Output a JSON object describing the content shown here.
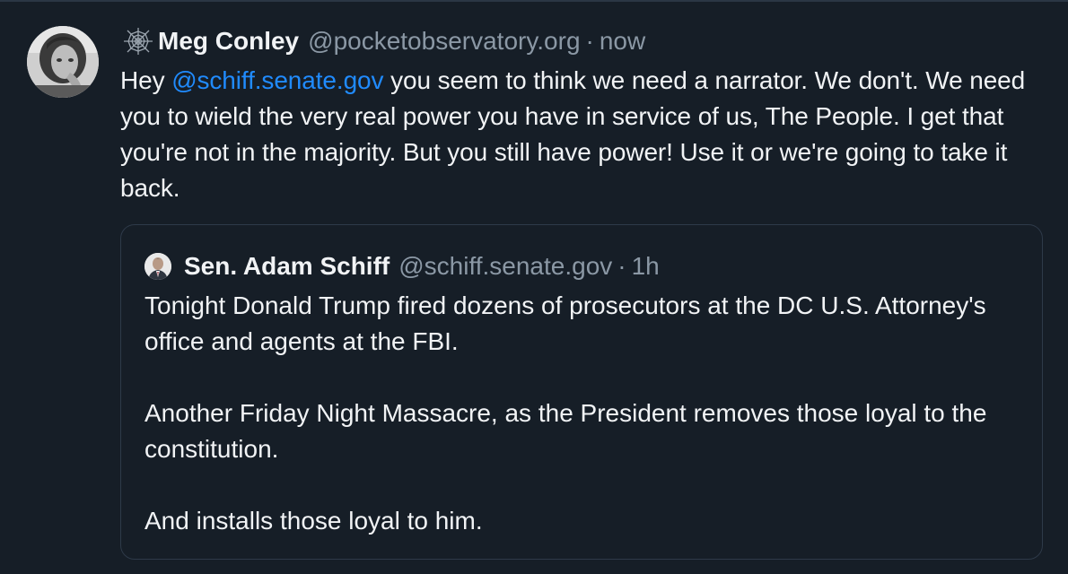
{
  "post": {
    "author": {
      "avatar_icon": "profile-photo-avatar",
      "badge_icon": "spiderweb-icon",
      "display_name": "Meg Conley",
      "handle": "@pocketobservatory.org",
      "separator": "·",
      "time": "now"
    },
    "text": {
      "before_mention": "Hey ",
      "mention": "@schiff.senate.gov",
      "after_mention": " you seem to think we need a narrator. We don't. We need you to wield the very real power you have in service of us, The People. I get that you're not in the majority. But you still have power! Use it or we're going to take it back."
    },
    "quote": {
      "author": {
        "avatar_icon": "profile-photo-avatar",
        "display_name": "Sen. Adam Schiff",
        "handle": "@schiff.senate.gov",
        "separator": "·",
        "time": "1h"
      },
      "paragraphs": [
        "Tonight Donald Trump fired dozens of prosecutors at the DC U.S. Attorney's office and agents at the FBI.",
        "Another Friday Night Massacre, as the President removes those loyal to the constitution.",
        "And installs those loyal to him."
      ]
    }
  },
  "colors": {
    "background": "#161e27",
    "text": "#f1f3f5",
    "muted": "#8b98a5",
    "link": "#208bfe",
    "border": "#2e3a49"
  }
}
